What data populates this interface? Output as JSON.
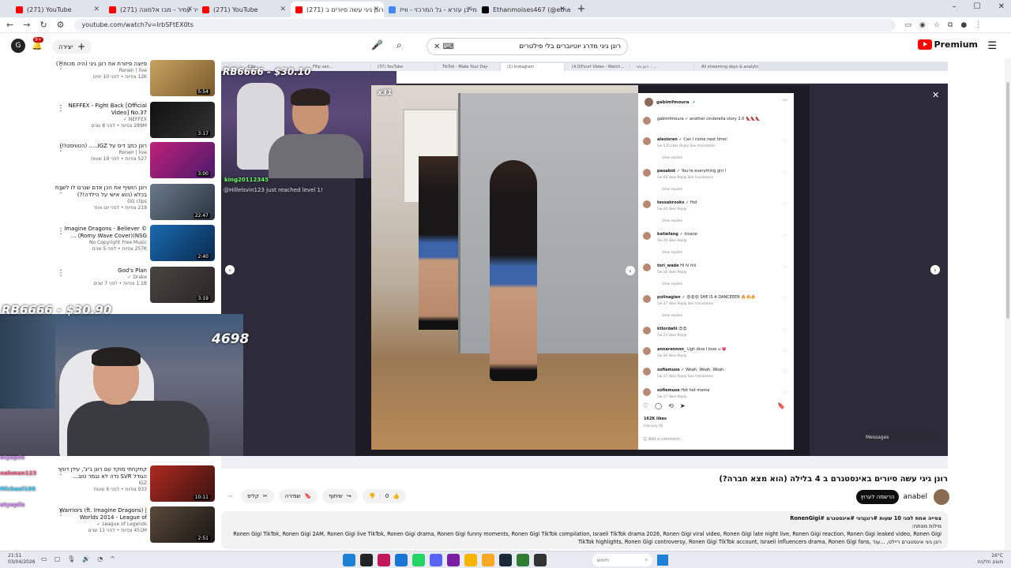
{
  "browser": {
    "tabs": [
      {
        "title": "(271) YouTube",
        "active": false,
        "color": "#ff0000"
      },
      {
        "title": "(271) כמיר עמיר - מבו אלמונה",
        "active": false,
        "color": "#ff0000"
      },
      {
        "title": "(271) YouTube",
        "active": false,
        "color": "#ff0000"
      },
      {
        "title": "(271) רונן גיגי עשה סיורים ב",
        "active": true,
        "color": "#ff0000"
      },
      {
        "title": "שלומי בן עזרא - גל המרכזי - ווייז",
        "active": false,
        "color": "#4285f4"
      },
      {
        "title": "Ethanmoises467 (@ethanmoise",
        "active": false,
        "color": "#000000"
      }
    ],
    "url": "youtube.com/watch?v=IrbSFtEX0ts"
  },
  "youtube": {
    "search_value": "רונן גיגי מדרג יוטיוברים בלי פילטרים",
    "create_label": "יצירה",
    "notif_count": "9+",
    "premium": "Premium",
    "avatar_letter": "G"
  },
  "recs": [
    {
      "title": "פיוצה פיזורת את רונן גיגי (היה מכות!?)",
      "channel": "Ronen | live",
      "meta": "12K צפיות • לפני 10 ימים",
      "dur": "5:54",
      "c1": "#c7a260",
      "c2": "#7a5a2c"
    },
    {
      "title": "NEFFEX - Fight Back [Official Video] No.37",
      "channel": "NEFFEX ✓",
      "meta": "289M צפיות • לפני 8 שנים",
      "dur": "3:17",
      "c1": "#111111",
      "c2": "#333333"
    },
    {
      "title": "רונן כתב דיס על IGZ..... (הטוויסט!!)",
      "channel": "Ronen | live",
      "meta": "527 צפיות • לפני 19 שעות",
      "dur": "3:00",
      "c1": "#c0207a",
      "c2": "#4a1a6a"
    },
    {
      "title": "רונן הושיף את הכן אדם שגרם לו לשבת בכלא (הוא אישי על הילדה!?)",
      "channel": "GG clips",
      "meta": "219 צפיות • לפני יום אחד",
      "dur": "22:47",
      "c1": "#6a7a8a",
      "c2": "#2a3440"
    },
    {
      "title": "Imagine Dragons - Believer © (Romy Wave Cover)(NSG ...",
      "channel": "No Copyright Free Music",
      "meta": "257K צפיות • לפני 5 שנים",
      "dur": "2:40",
      "c1": "#1a6ab0",
      "c2": "#0a2a50"
    },
    {
      "title": "God's Plan",
      "channel": "Drake ✓",
      "meta": "1.1B צפיות • לפני 7 שנים",
      "dur": "3:19",
      "c1": "#4a4440",
      "c2": "#2a2624"
    },
    {
      "title": "קחקחתי מוקד עם רונן ג'יג', עידן דוהר הגודל SVR נדה לא נגמר טוב...",
      "channel": "IGZ",
      "meta": "933 צפיות • לפני 6 שעות",
      "dur": "10:11",
      "c1": "#b02a20",
      "c2": "#3a1210"
    },
    {
      "title": "Warriors (ft. Imagine Dragons) | Worlds 2014 - League of",
      "channel": "League of Legends ✓",
      "meta": "451M צפיות • לפני 11 שנים",
      "dur": "2:51",
      "c1": "#5a4a3a",
      "c2": "#1a1614"
    }
  ],
  "player": {
    "inner_tabs": [
      "Clip - …",
      "Filip van…",
      "(37) YouTube",
      "TikTok - Make Your Day",
      "(1) Instagram",
      "(4,0)Fourt Views - Watch…",
      "רונן גיגי - …",
      "All streaming days & analytics"
    ],
    "score_top": "RB6666 - $30.10",
    "score_badge": "x31",
    "score_mid": "RB6666 - $30.90",
    "score_big": "4698",
    "chat_user": "king20112345",
    "chat_msg": "@Hillelsvin123 just reached level 1!",
    "msg_pill": "Messages"
  },
  "ig": {
    "author": "gabimfmoura",
    "caption": "gabimfmoura ✓ another cinderella story 2.0 👠👠👠",
    "comments": [
      {
        "user": "alexisren ✓",
        "text": "Can I come next time!",
        "meta": "5w   535 likes   Reply   See translation"
      },
      {
        "user": "paoabot ✓",
        "text": "You're everything girl !",
        "meta": "5w   68 likes   Reply   See translation"
      },
      {
        "user": "tessabrooks ✓",
        "text": "Hot",
        "meta": "5w   44 likes   Reply"
      },
      {
        "user": "katiefang ✓",
        "text": "Insane",
        "meta": "5w   29 likes   Reply"
      },
      {
        "user": "tori_wade",
        "text": "Hi hi hiii",
        "meta": "5w   26 likes   Reply"
      },
      {
        "user": "polinagien ✓",
        "text": "😍😍😍 SHE IS A DANCEEER 🔥🔥🔥",
        "meta": "5w   37 likes   Reply   See translation"
      },
      {
        "user": "ktlordahl",
        "text": "😍😍",
        "meta": "5w   23 likes   Reply"
      },
      {
        "user": "annarennnn_",
        "text": "Ugh diva I love u 💗",
        "meta": "5w   26 likes   Reply"
      },
      {
        "user": "sofiamuse ✓",
        "text": "Woah. Woah. Woah.",
        "meta": "5w   27 likes   Reply   See translation"
      },
      {
        "user": "sofiemuse",
        "text": "Hot hot mama",
        "meta": "5w   27 likes   Reply"
      }
    ],
    "view_replies": "View replies",
    "likes": "162K likes",
    "date": "February 26",
    "add_comment": "Add a comment..."
  },
  "chat_names": [
    {
      "name": "etyopiis",
      "color": "#d88cff"
    },
    {
      "name": "nahman123",
      "color": "#ff5e8a"
    },
    {
      "name": "Michael166",
      "color": "#44d4ff"
    },
    {
      "name": "etyopiis",
      "color": "#d88cff"
    }
  ],
  "video": {
    "title": "רונן גיגי עשה סיורים באינסטגרם ב 4 בלילה (הוא מצא חברה?)",
    "channel": "anabel",
    "subscribe": "הרשמה לערוץ",
    "likes": "0",
    "share": "שיתוף",
    "save": "שמירה",
    "clip": "קליפ",
    "desc_meta": "צפייה אחת  לפני 10 שעות  #רונןגיגי  #אינסטגרם  #RonenGigi",
    "desc_sub": "מילות מפתח:",
    "desc_tags": "Ronen Gigi TikTok, Ronen Gigi 2AM, Ronen Gigi live TikTok, Ronen Gigi drama, Ronen Gigi funny moments, Ronen Gigi TikTok compilation, Israeli TikTok drama 2026, Ronen Gigi viral video, Ronen Gigi late night live, Ronen Gigi reaction, Ronen Gigi leaked video, Ronen Gigi TikTok highlights, Ronen Gigi controversy, Ronen Gigi TikTok account, Israeli influencers drama, Ronen Gigi fans, רונן גיגי אינסטגרם ריילס, ...עוד"
  },
  "taskbar": {
    "time": "21:51",
    "date": "03/04/2026",
    "search": "חיפוש",
    "weather": "16°C",
    "weather_sub": "מעונן חלקית"
  }
}
